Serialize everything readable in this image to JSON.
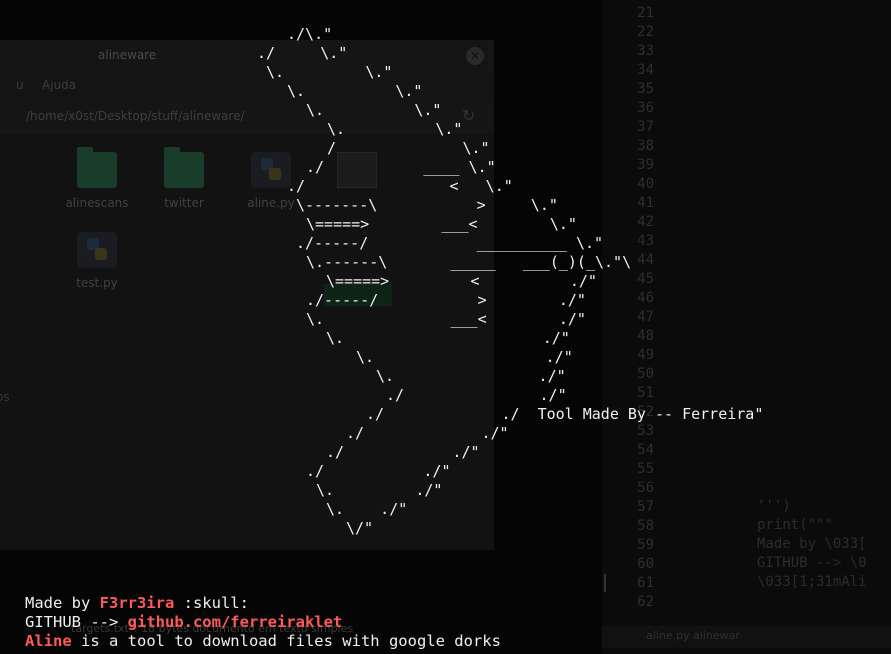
{
  "file_manager": {
    "title": "alineware",
    "menu": [
      "u",
      "Ajuda"
    ],
    "path": "/home/x0st/Desktop/stuff/alineware/",
    "files": [
      {
        "name": "alinescans",
        "type": "folder"
      },
      {
        "name": "twitter",
        "type": "folder"
      },
      {
        "name": "aline.py",
        "type": "python"
      },
      {
        "name": "test.py",
        "type": "python"
      }
    ],
    "sidebar_fragment": "os",
    "status": "\"targets.txt\": 18 bytes documento em texto simples"
  },
  "editor": {
    "line_numbers": [
      "21",
      "22",
      "33",
      "34",
      "35",
      "36",
      "37",
      "38",
      "39",
      "40",
      "41",
      "42",
      "43",
      "44",
      "45",
      "46",
      "47",
      "48",
      "49",
      "50",
      "51",
      "52",
      "53",
      "54",
      "55",
      "56",
      "57",
      "58",
      "59",
      "60",
      "61",
      "62"
    ],
    "code_lines": [
      "''')",
      "print(\"\"\"",
      "Made by \\033[",
      "GITHUB --> \\0",
      "\\033[1;31mAli"
    ],
    "status": "aline.py  alinewar"
  },
  "ascii_art": [
    {
      "text": "./\\.\""
    },
    {
      "text": "./     \\.\""
    },
    {
      "text": "\\.         \\.\""
    },
    {
      "text": "\\.          \\.\""
    },
    {
      "text": "\\.          \\.\""
    },
    {
      "text": "\\.          \\.\""
    },
    {
      "text": "/              \\.\""
    },
    {
      "text": "./           ____ \\.\""
    },
    {
      "text": "./                <   \\.\""
    },
    {
      "text": "\\-------\\           >     \\.\""
    },
    {
      "text": "\\=====>        ___<        \\.\""
    },
    {
      "text": "./-----/            __________ \\.\""
    },
    {
      "text": "\\.------\\       _____   ___(_)(_\\.\"\\"
    },
    {
      "text": "\\=====>         <          ./\""
    },
    {
      "text": "./-----/           >        ./\""
    },
    {
      "text": "\\.              ___<        ./\""
    },
    {
      "text": "\\.                      ./\""
    },
    {
      "text": "\\.                   ./\""
    },
    {
      "text": "\\.                ./\""
    },
    {
      "text": "./               ./\""
    },
    {
      "text": "./             ./  Tool Made By -- Ferreira\""
    },
    {
      "text": "./             ./\""
    },
    {
      "text": "./            ./\""
    },
    {
      "text": "./           ./\""
    },
    {
      "text": "\\.         ./\""
    },
    {
      "text": "\\.    ./\""
    },
    {
      "text": "\\/\""
    }
  ],
  "banner": {
    "line1_prefix": "Made by ",
    "line1_name": "F3rr3ira",
    "line1_suffix": " :skull:",
    "line2_prefix": "GITHUB --> ",
    "line2_link": "github.com/ferreiraklet",
    "line3_name": "Aline",
    "line3_suffix": " is a tool to download files with google dorks"
  },
  "colors": {
    "accent_red": "#ff5a5a",
    "terminal_bg": "#050505"
  }
}
